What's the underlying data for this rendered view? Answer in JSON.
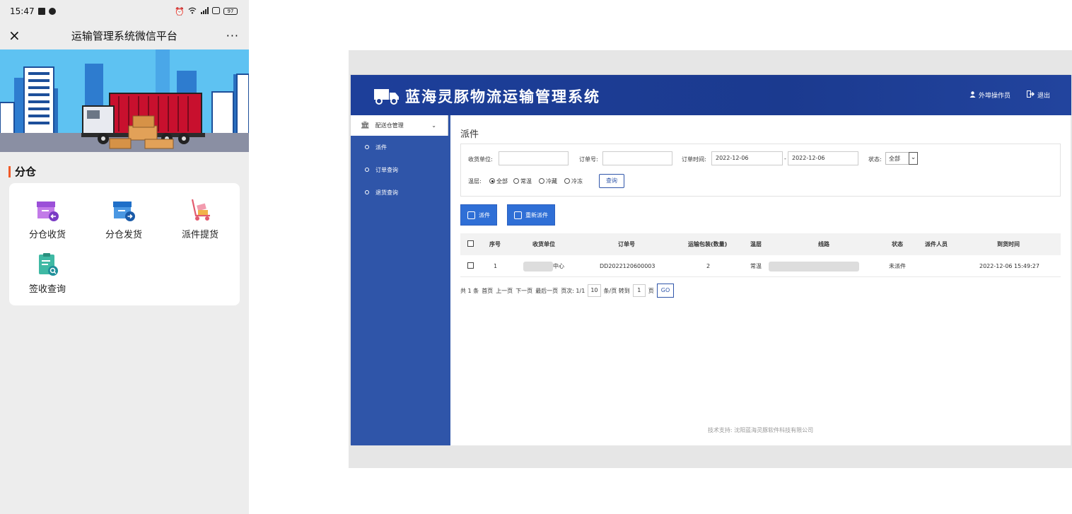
{
  "phone": {
    "status": {
      "time": "15:47",
      "battery": "97"
    },
    "nav": {
      "close": "×",
      "title": "运输管理系统微信平台",
      "more": "···"
    },
    "section_title": "分仓",
    "grid": [
      {
        "label": "分仓收货",
        "icon": "warehouse-receive-icon"
      },
      {
        "label": "分仓发货",
        "icon": "warehouse-send-icon"
      },
      {
        "label": "派件提货",
        "icon": "delivery-pickup-icon"
      },
      {
        "label": "签收查询",
        "icon": "sign-query-icon"
      }
    ]
  },
  "app": {
    "title": "蓝海灵豚物流运输管理系统",
    "user": "外埠操作员",
    "logout": "退出",
    "sidebar": {
      "group": "配送仓管理",
      "items": [
        "派件",
        "订单查询",
        "退货查询"
      ]
    },
    "page_title": "派件",
    "filters": {
      "receiver_label": "收货单位:",
      "receiver_value": "",
      "order_label": "订单号:",
      "order_value": "",
      "time_label": "订单时间:",
      "date_from": "2022-12-06",
      "date_sep": "-",
      "date_to": "2022-12-06",
      "status_label": "状态:",
      "status_value": "全部",
      "temp_label": "温层:",
      "temp_options": [
        "全部",
        "常温",
        "冷藏",
        "冷冻"
      ],
      "temp_selected": "全部",
      "query_button": "查询"
    },
    "actions": {
      "dispatch": "派件",
      "redispatch": "重新派件"
    },
    "table": {
      "headers": [
        "序号",
        "收货单位",
        "订单号",
        "运输包装(数量)",
        "温层",
        "线路",
        "状态",
        "派件人员",
        "到货时间"
      ],
      "rows": [
        {
          "index": "1",
          "receiver": "中心",
          "order_no": "DD2022120600003",
          "qty": "2",
          "temp": "常温",
          "route": "",
          "status": "未派件",
          "dispatcher": "",
          "arrival": "2022-12-06 15:49:27"
        }
      ]
    },
    "pager": {
      "total": "共 1 条",
      "first": "首页",
      "prev": "上一页",
      "next": "下一页",
      "last": "最后一页",
      "page_info": "页次: 1/1",
      "page_size": "10",
      "per_page": "条/页 转到",
      "goto_page": "1",
      "page_unit": "页",
      "go": "GO"
    },
    "footer": "技术支持: 沈阳蓝海灵豚软件科技有限公司"
  }
}
